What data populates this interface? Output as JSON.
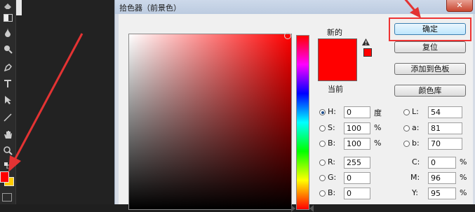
{
  "dialog": {
    "title": "拾色器（前景色）",
    "close_glyph": "✕",
    "new_label": "新的",
    "current_label": "当前",
    "buttons": {
      "ok": "确定",
      "reset": "复位",
      "add_to_swatches": "添加到色板",
      "color_libraries": "颜色库"
    },
    "fields": {
      "H": {
        "label": "H:",
        "value": "0",
        "unit": "度"
      },
      "S": {
        "label": "S:",
        "value": "100",
        "unit": "%"
      },
      "B": {
        "label": "B:",
        "value": "100",
        "unit": "%"
      },
      "R": {
        "label": "R:",
        "value": "255"
      },
      "G": {
        "label": "G:",
        "value": "0"
      },
      "Bl": {
        "label": "B:",
        "value": "0"
      },
      "L": {
        "label": "L:",
        "value": "54"
      },
      "a": {
        "label": "a:",
        "value": "81"
      },
      "b": {
        "label": "b:",
        "value": "70"
      },
      "C": {
        "label": "C:",
        "value": "0",
        "unit": "%"
      },
      "M": {
        "label": "M:",
        "value": "96",
        "unit": "%"
      },
      "Y": {
        "label": "Y:",
        "value": "95",
        "unit": "%"
      }
    },
    "selected_mode": "H"
  },
  "colors": {
    "foreground": "#ff0000",
    "background": "#ffcc00",
    "annotation": "#e33333"
  },
  "toolbar": {
    "icons": [
      "eraser-icon",
      "gradient-icon",
      "blur-icon",
      "dodge-icon",
      "pen-icon",
      "type-icon",
      "path-select-icon",
      "line-icon",
      "hand-icon",
      "zoom-icon"
    ]
  }
}
